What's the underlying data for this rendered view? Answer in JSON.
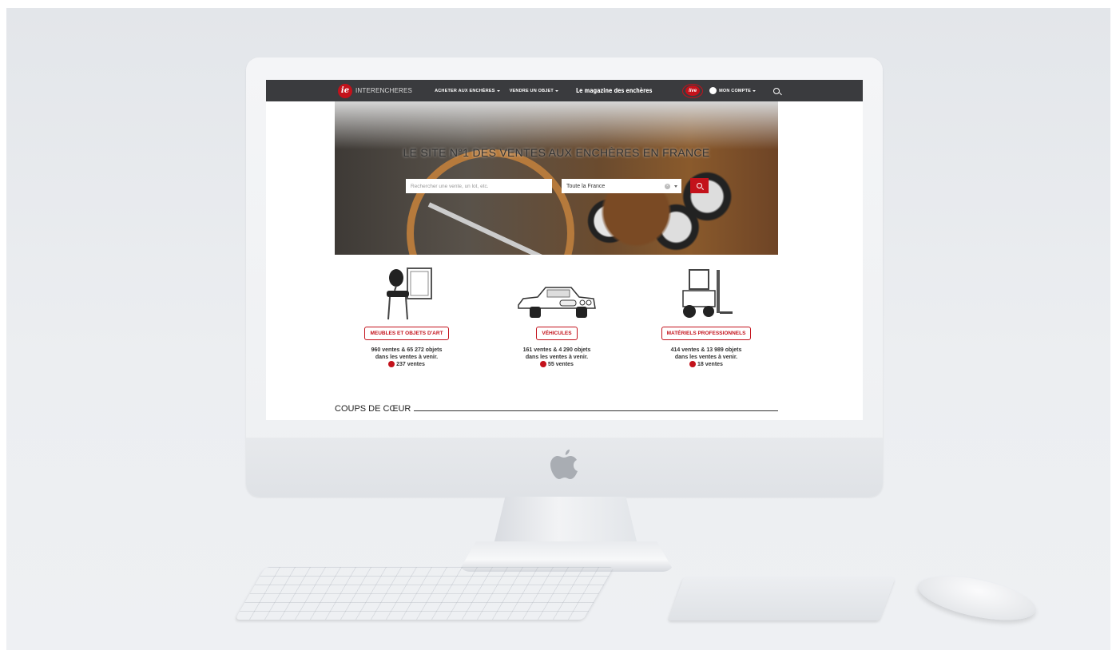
{
  "nav": {
    "logo_text": "INTERENCHERES",
    "logo_mark": "ie",
    "items": [
      "ACHETER AUX ENCHÈRES",
      "VENDRE UN OBJET"
    ],
    "magazine": "Le magazine des enchères",
    "live": "live",
    "account": "MON COMPTE"
  },
  "hero": {
    "title": "LE SITE N°1 DES VENTES AUX ENCHÈRES EN FRANCE",
    "search_placeholder": "Rechercher une vente, un lot, etc.",
    "location_value": "Toute la France"
  },
  "categories": [
    {
      "label": "MEUBLES ET OBJETS D'ART",
      "stats_line1": "960 ventes & 65 272 objets",
      "stats_line2": "dans les ventes à venir.",
      "live_count": "237 ventes"
    },
    {
      "label": "VÉHICULES",
      "stats_line1": "161 ventes & 4 290 objets",
      "stats_line2": "dans les ventes à venir.",
      "live_count": "55 ventes"
    },
    {
      "label": "MATÉRIELS PROFESSIONNELS",
      "stats_line1": "414 ventes & 13 989 objets",
      "stats_line2": "dans les ventes à venir.",
      "live_count": "18 ventes"
    }
  ],
  "section": {
    "coups_de_coeur": "COUPS DE CŒUR"
  },
  "colors": {
    "brand_red": "#c3121b",
    "navbar": "#3a3b3e"
  }
}
